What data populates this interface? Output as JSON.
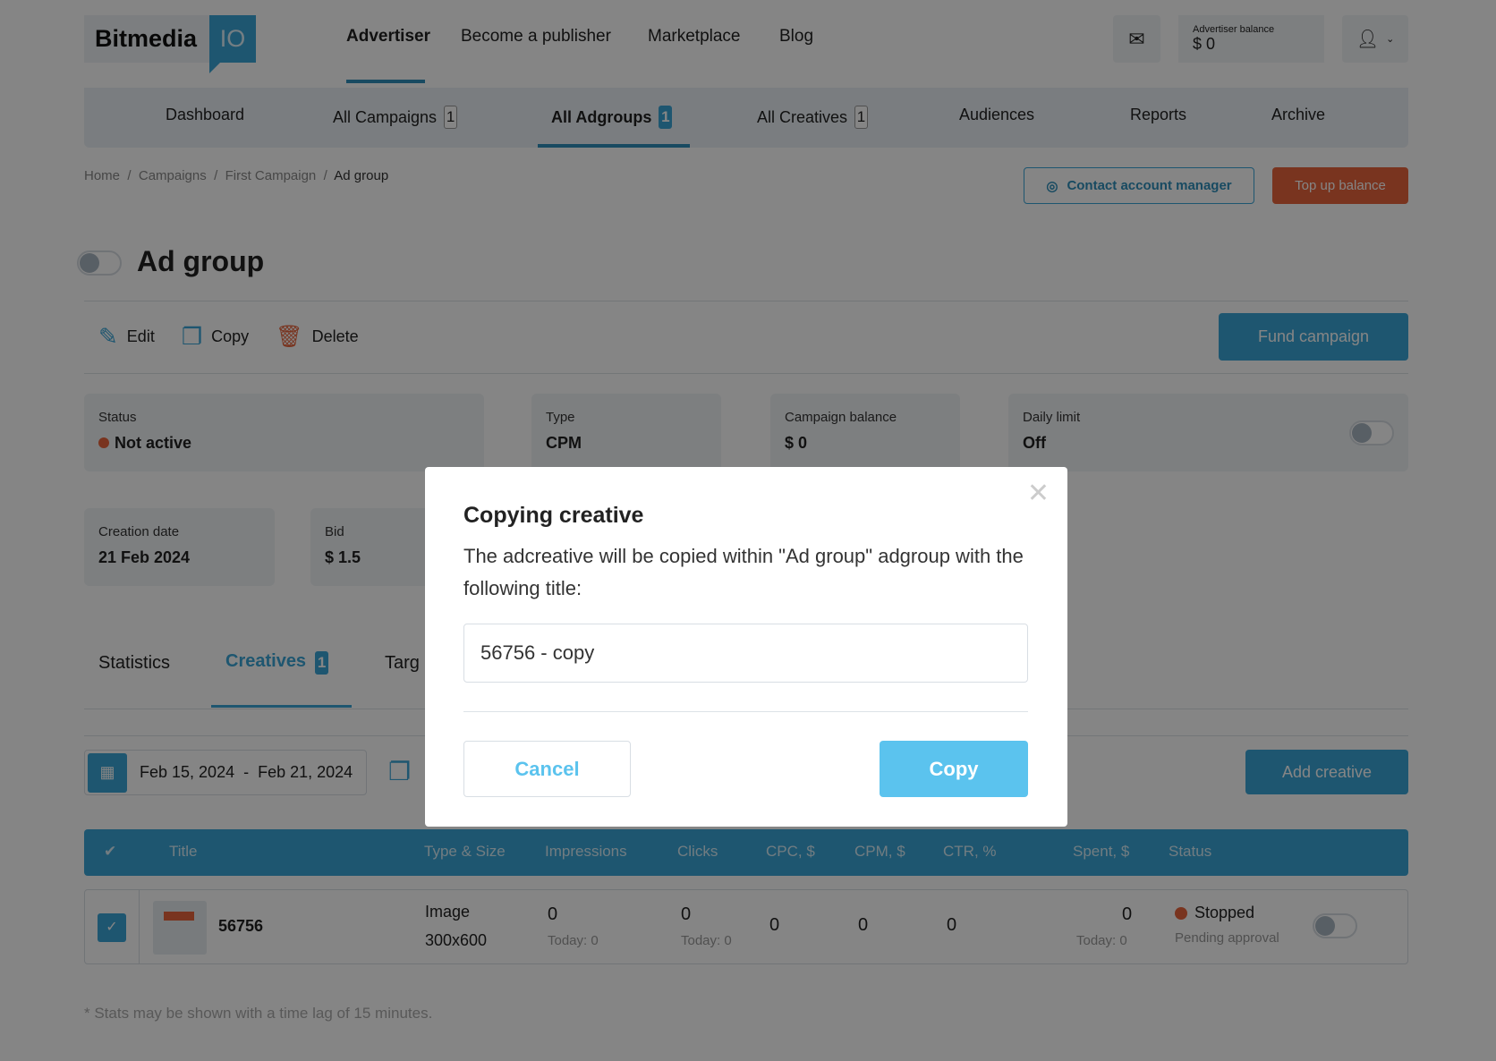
{
  "header": {
    "logo_text": "Bitmedia",
    "logo_suffix": "IO",
    "nav": [
      "Advertiser",
      "Become a publisher",
      "Marketplace",
      "Blog"
    ],
    "balance_label": "Advertiser balance",
    "balance_value": "$ 0"
  },
  "subnav": [
    {
      "label": "Dashboard"
    },
    {
      "label": "All Campaigns",
      "count": "1"
    },
    {
      "label": "All Adgroups",
      "count": "1"
    },
    {
      "label": "All Creatives",
      "count": "1"
    },
    {
      "label": "Audiences"
    },
    {
      "label": "Reports"
    },
    {
      "label": "Archive"
    }
  ],
  "breadcrumb": [
    "Home",
    "Campaigns",
    "First Campaign",
    "Ad group"
  ],
  "actions": {
    "contact": "Contact account manager",
    "topup": "Top up balance",
    "edit": "Edit",
    "copy": "Copy",
    "delete": "Delete",
    "fund": "Fund campaign"
  },
  "page_title": "Ad group",
  "cards": {
    "status_label": "Status",
    "status_value": "Not active",
    "type_label": "Type",
    "type_value": "CPM",
    "balance_label": "Campaign balance",
    "balance_value": "$ 0",
    "daily_label": "Daily limit",
    "daily_value": "Off",
    "created_label": "Creation date",
    "created_value": "21 Feb 2024",
    "bid_label": "Bid",
    "bid_value": "$ 1.5"
  },
  "tabs": {
    "statistics": "Statistics",
    "creatives": "Creatives",
    "creatives_count": "1",
    "targeting": "Targ"
  },
  "date_range": "Feb 15, 2024  -  Feb 21, 2024",
  "add_creative": "Add creative",
  "table": {
    "headers": [
      "Title",
      "Type & Size",
      "Impressions",
      "Clicks",
      "CPC, $",
      "CPM, $",
      "CTR, %",
      "Spent, $",
      "Status"
    ],
    "row": {
      "title": "56756",
      "type": "Image",
      "size": "300x600",
      "impressions": "0",
      "impressions_today": "Today: 0",
      "clicks": "0",
      "clicks_today": "Today: 0",
      "cpc": "0",
      "cpm": "0",
      "ctr": "0",
      "spent": "0",
      "spent_today": "Today: 0",
      "status": "Stopped",
      "status_sub": "Pending approval"
    }
  },
  "footnote": "* Stats may be shown with a time lag of 15 minutes.",
  "modal": {
    "title": "Copying creative",
    "text": "The adcreative will be copied within \"Ad group\" adgroup with the following title:",
    "input_value": "56756 - copy",
    "cancel": "Cancel",
    "copy": "Copy"
  },
  "colors": {
    "accent": "#3aa6d6",
    "danger": "#e8643c"
  }
}
